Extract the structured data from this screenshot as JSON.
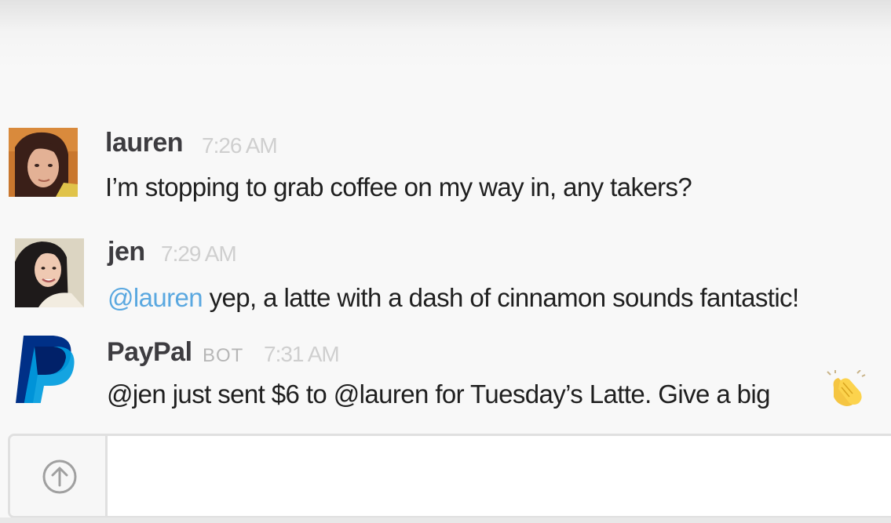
{
  "messages": [
    {
      "author": "lauren",
      "time": "7:26 AM",
      "text": "I’m stopping to grab coffee on my way in, any takers?"
    },
    {
      "author": "jen",
      "time": "7:29 AM",
      "mention": "@lauren",
      "text": " yep, a latte with a dash of cinnamon sounds fantastic!"
    },
    {
      "author": "PayPal",
      "bot_label": "BOT",
      "time": "7:31 AM",
      "text": "@jen just sent $6 to @lauren for Tuesday’s Latte. Give a big",
      "emoji": "clapping-hands"
    }
  ],
  "composer": {
    "placeholder": "",
    "upload_icon": "arrow-up-circle-icon"
  },
  "colors": {
    "mention": "#5aa8e0",
    "paypal_dark": "#003087",
    "paypal_light": "#009cde",
    "timestamp": "#cfcfcf"
  }
}
